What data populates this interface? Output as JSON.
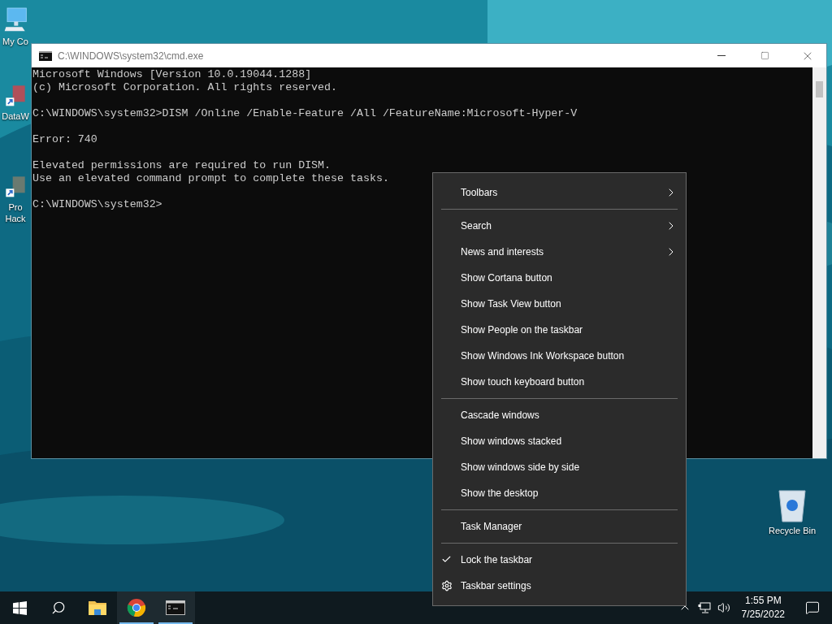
{
  "desktop_icons": [
    {
      "label": "My Co"
    },
    {
      "label": "DataW"
    },
    {
      "label": "Pro\nHack"
    }
  ],
  "recycle_bin": {
    "label": "Recycle Bin"
  },
  "console_window": {
    "title": "C:\\WINDOWS\\system32\\cmd.exe",
    "blocks": [
      [
        "Microsoft Windows [Version 10.0.19044.1288]",
        "(c) Microsoft Corporation. All rights reserved."
      ],
      [
        "C:\\WINDOWS\\system32>DISM /Online /Enable-Feature /All /FeatureName:Microsoft-Hyper-V"
      ],
      [
        "Error: 740"
      ],
      [
        "Elevated permissions are required to run DISM.",
        "Use an elevated command prompt to complete these tasks."
      ],
      [
        "C:\\WINDOWS\\system32>"
      ]
    ]
  },
  "context_menu": {
    "groups": [
      [
        {
          "label": "Toolbars",
          "kind": "submenu",
          "checked": false
        }
      ],
      [
        {
          "label": "Search",
          "kind": "submenu",
          "checked": false
        },
        {
          "label": "News and interests",
          "kind": "submenu",
          "checked": false
        },
        {
          "label": "Show Cortana button",
          "kind": "command",
          "checked": false
        },
        {
          "label": "Show Task View button",
          "kind": "command",
          "checked": false
        },
        {
          "label": "Show People on the taskbar",
          "kind": "command",
          "checked": false
        },
        {
          "label": "Show Windows Ink Workspace button",
          "kind": "command",
          "checked": false
        },
        {
          "label": "Show touch keyboard button",
          "kind": "command",
          "checked": false
        }
      ],
      [
        {
          "label": "Cascade windows",
          "kind": "command",
          "checked": false
        },
        {
          "label": "Show windows stacked",
          "kind": "command",
          "checked": false
        },
        {
          "label": "Show windows side by side",
          "kind": "command",
          "checked": false
        },
        {
          "label": "Show the desktop",
          "kind": "command",
          "checked": false
        }
      ],
      [
        {
          "label": "Task Manager",
          "kind": "command",
          "checked": false
        }
      ],
      [
        {
          "label": "Lock the taskbar",
          "kind": "command",
          "checked": true
        },
        {
          "label": "Taskbar settings",
          "kind": "settings",
          "checked": false
        }
      ]
    ]
  },
  "taskbar": {
    "apps": [
      {
        "kind": "folder",
        "running": false
      },
      {
        "kind": "browser",
        "running": true
      },
      {
        "kind": "console",
        "running": true
      }
    ],
    "clock": {
      "time": "1:55 PM",
      "date": "7/25/2022"
    }
  }
}
